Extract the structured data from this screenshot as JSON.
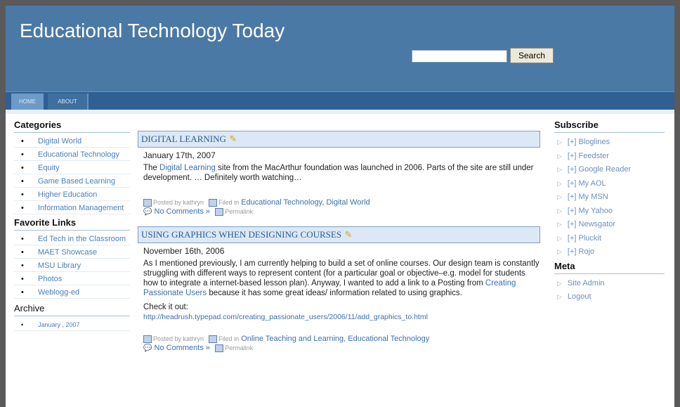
{
  "site": {
    "title": "Educational Technology Today"
  },
  "search": {
    "placeholder": "",
    "button_label": "Search"
  },
  "nav": {
    "tabs": [
      {
        "label": "HOME"
      },
      {
        "label": "ABOUT"
      }
    ]
  },
  "left_sidebar": {
    "categories_heading": "Categories",
    "categories": [
      "Digital World",
      "Educational Technology",
      "Equity",
      "Game Based Learning",
      "Higher Education",
      "Information Management"
    ],
    "favorites_heading": "Favorite Links",
    "favorites": [
      "Ed Tech in the Classroom",
      "MAET Showcase",
      "MSU Library",
      "Photos",
      "Weblogg-ed"
    ],
    "archive_heading": "Archive",
    "archive": [
      "January , 2007"
    ]
  },
  "posts": [
    {
      "title": "DIGITAL LEARNING",
      "date": "January 17th, 2007",
      "body_pre": "The ",
      "body_link": "Digital Learning",
      "body_post": " site from the MacArthur foundation was launched in 2006. Parts of the site are still under development. … Definitely worth watching…",
      "posted_by": "Posted by kathryn",
      "filed_in_label": "Filed in",
      "filed_in": "Educational Technology, Digital World",
      "comments": "No Comments »",
      "permalink": "Permalink"
    },
    {
      "title": "USING GRAPHICS WHEN DESIGNING COURSES",
      "date": "November 16th, 2006",
      "body_pre": "As I mentioned previously, I am currently helping to build a set of online courses. Our design team is constantly struggling with different ways to represent content (for a particular goal or objective–e.g. model for students how to integrate a internet-based lesson plan). Anyway, I wanted to add a link to a Posting from ",
      "body_link": "Creating Passionate Users",
      "body_post": " because it has some great ideas/ information related to using graphics.",
      "check_label": "Check it out:",
      "check_link": "http://headrush.typepad.com/creating_passionate_users/2006/11/add_graphics_to.html",
      "posted_by": "Posted by kathryn",
      "filed_in_label": "Filed in",
      "filed_in": "Online Teaching and Learning, Educational Technology",
      "comments": "No Comments »",
      "permalink": "Permalink"
    }
  ],
  "right_sidebar": {
    "subscribe_heading": "Subscribe",
    "subscribe": [
      "[+] Bloglines",
      "[+] Feedster",
      "[+] Google Reader",
      "[+] My AOL",
      "[+] My MSN",
      "[+] My Yahoo",
      "[+] Newsgator",
      "[+] Pluckit",
      "[+] Rojo"
    ],
    "meta_heading": "Meta",
    "meta": [
      "Site Admin",
      "Logout"
    ]
  },
  "icons": {
    "bullet": "•",
    "arrow": "▷",
    "pencil": "✎",
    "comment": "💬"
  },
  "colors": {
    "header": "#4a79a6",
    "navbar": "#2f5f93",
    "link": "#3b6fb0",
    "title_box": "#dce8f5"
  }
}
